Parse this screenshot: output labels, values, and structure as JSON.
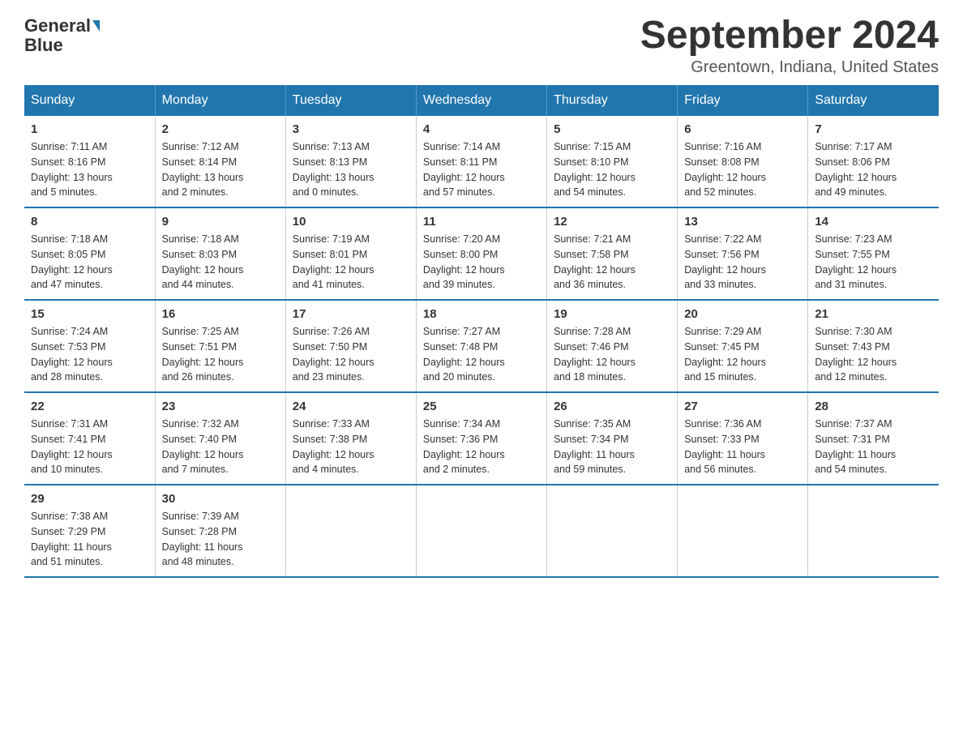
{
  "header": {
    "logo_general": "General",
    "logo_blue": "Blue",
    "month_title": "September 2024",
    "location": "Greentown, Indiana, United States"
  },
  "days_of_week": [
    "Sunday",
    "Monday",
    "Tuesday",
    "Wednesday",
    "Thursday",
    "Friday",
    "Saturday"
  ],
  "weeks": [
    [
      {
        "day": "1",
        "sunrise": "7:11 AM",
        "sunset": "8:16 PM",
        "daylight": "13 hours and 5 minutes."
      },
      {
        "day": "2",
        "sunrise": "7:12 AM",
        "sunset": "8:14 PM",
        "daylight": "13 hours and 2 minutes."
      },
      {
        "day": "3",
        "sunrise": "7:13 AM",
        "sunset": "8:13 PM",
        "daylight": "13 hours and 0 minutes."
      },
      {
        "day": "4",
        "sunrise": "7:14 AM",
        "sunset": "8:11 PM",
        "daylight": "12 hours and 57 minutes."
      },
      {
        "day": "5",
        "sunrise": "7:15 AM",
        "sunset": "8:10 PM",
        "daylight": "12 hours and 54 minutes."
      },
      {
        "day": "6",
        "sunrise": "7:16 AM",
        "sunset": "8:08 PM",
        "daylight": "12 hours and 52 minutes."
      },
      {
        "day": "7",
        "sunrise": "7:17 AM",
        "sunset": "8:06 PM",
        "daylight": "12 hours and 49 minutes."
      }
    ],
    [
      {
        "day": "8",
        "sunrise": "7:18 AM",
        "sunset": "8:05 PM",
        "daylight": "12 hours and 47 minutes."
      },
      {
        "day": "9",
        "sunrise": "7:18 AM",
        "sunset": "8:03 PM",
        "daylight": "12 hours and 44 minutes."
      },
      {
        "day": "10",
        "sunrise": "7:19 AM",
        "sunset": "8:01 PM",
        "daylight": "12 hours and 41 minutes."
      },
      {
        "day": "11",
        "sunrise": "7:20 AM",
        "sunset": "8:00 PM",
        "daylight": "12 hours and 39 minutes."
      },
      {
        "day": "12",
        "sunrise": "7:21 AM",
        "sunset": "7:58 PM",
        "daylight": "12 hours and 36 minutes."
      },
      {
        "day": "13",
        "sunrise": "7:22 AM",
        "sunset": "7:56 PM",
        "daylight": "12 hours and 33 minutes."
      },
      {
        "day": "14",
        "sunrise": "7:23 AM",
        "sunset": "7:55 PM",
        "daylight": "12 hours and 31 minutes."
      }
    ],
    [
      {
        "day": "15",
        "sunrise": "7:24 AM",
        "sunset": "7:53 PM",
        "daylight": "12 hours and 28 minutes."
      },
      {
        "day": "16",
        "sunrise": "7:25 AM",
        "sunset": "7:51 PM",
        "daylight": "12 hours and 26 minutes."
      },
      {
        "day": "17",
        "sunrise": "7:26 AM",
        "sunset": "7:50 PM",
        "daylight": "12 hours and 23 minutes."
      },
      {
        "day": "18",
        "sunrise": "7:27 AM",
        "sunset": "7:48 PM",
        "daylight": "12 hours and 20 minutes."
      },
      {
        "day": "19",
        "sunrise": "7:28 AM",
        "sunset": "7:46 PM",
        "daylight": "12 hours and 18 minutes."
      },
      {
        "day": "20",
        "sunrise": "7:29 AM",
        "sunset": "7:45 PM",
        "daylight": "12 hours and 15 minutes."
      },
      {
        "day": "21",
        "sunrise": "7:30 AM",
        "sunset": "7:43 PM",
        "daylight": "12 hours and 12 minutes."
      }
    ],
    [
      {
        "day": "22",
        "sunrise": "7:31 AM",
        "sunset": "7:41 PM",
        "daylight": "12 hours and 10 minutes."
      },
      {
        "day": "23",
        "sunrise": "7:32 AM",
        "sunset": "7:40 PM",
        "daylight": "12 hours and 7 minutes."
      },
      {
        "day": "24",
        "sunrise": "7:33 AM",
        "sunset": "7:38 PM",
        "daylight": "12 hours and 4 minutes."
      },
      {
        "day": "25",
        "sunrise": "7:34 AM",
        "sunset": "7:36 PM",
        "daylight": "12 hours and 2 minutes."
      },
      {
        "day": "26",
        "sunrise": "7:35 AM",
        "sunset": "7:34 PM",
        "daylight": "11 hours and 59 minutes."
      },
      {
        "day": "27",
        "sunrise": "7:36 AM",
        "sunset": "7:33 PM",
        "daylight": "11 hours and 56 minutes."
      },
      {
        "day": "28",
        "sunrise": "7:37 AM",
        "sunset": "7:31 PM",
        "daylight": "11 hours and 54 minutes."
      }
    ],
    [
      {
        "day": "29",
        "sunrise": "7:38 AM",
        "sunset": "7:29 PM",
        "daylight": "11 hours and 51 minutes."
      },
      {
        "day": "30",
        "sunrise": "7:39 AM",
        "sunset": "7:28 PM",
        "daylight": "11 hours and 48 minutes."
      },
      null,
      null,
      null,
      null,
      null
    ]
  ],
  "labels": {
    "sunrise": "Sunrise:",
    "sunset": "Sunset:",
    "daylight": "Daylight:"
  }
}
